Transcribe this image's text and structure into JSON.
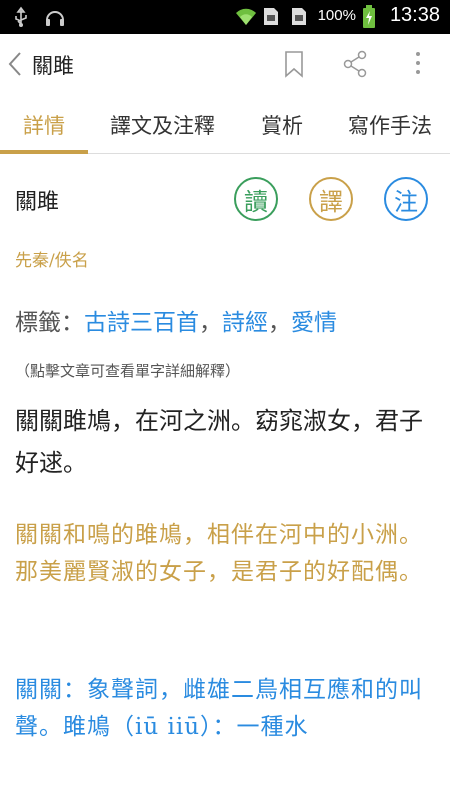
{
  "status_bar": {
    "battery_percent": "100%",
    "time": "13:38",
    "icons": [
      "usb-icon",
      "headset-icon",
      "wifi-icon",
      "sim1-icon",
      "sim2-icon",
      "battery-charging-icon"
    ]
  },
  "app_bar": {
    "title": "關雎",
    "icons": [
      "back-arrow-icon",
      "bookmark-icon",
      "share-icon",
      "more-vert-icon"
    ]
  },
  "tabs": [
    {
      "label": "詳情",
      "active": true
    },
    {
      "label": "譯文及注釋",
      "active": false
    },
    {
      "label": "賞析",
      "active": false
    },
    {
      "label": "寫作手法",
      "active": false
    }
  ],
  "content": {
    "title": "關雎",
    "action_buttons": {
      "read": "讀",
      "translate": "譯",
      "note": "注"
    },
    "dynasty_author": "先秦/佚名",
    "tags_label": "標籤：",
    "tags": [
      "古詩三百首",
      "詩經",
      "愛情"
    ],
    "tag_separator": "，",
    "hint": "（點擊文章可查看單字詳細解釋）",
    "poem": "關關雎鳩，在河之洲。窈窕淑女，君子好逑。",
    "translation": "關關和鳴的雎鳩，相伴在河中的小洲。那美麗賢淑的女子，是君子的好配偶。",
    "notes": "關關：象聲詞，雌雄二鳥相互應和的叫聲。雎鳩（iū iiū）：一種水"
  },
  "colors": {
    "accent_gold": "#c9a049",
    "read_green": "#3a9e5c",
    "note_blue": "#2a8be0"
  }
}
